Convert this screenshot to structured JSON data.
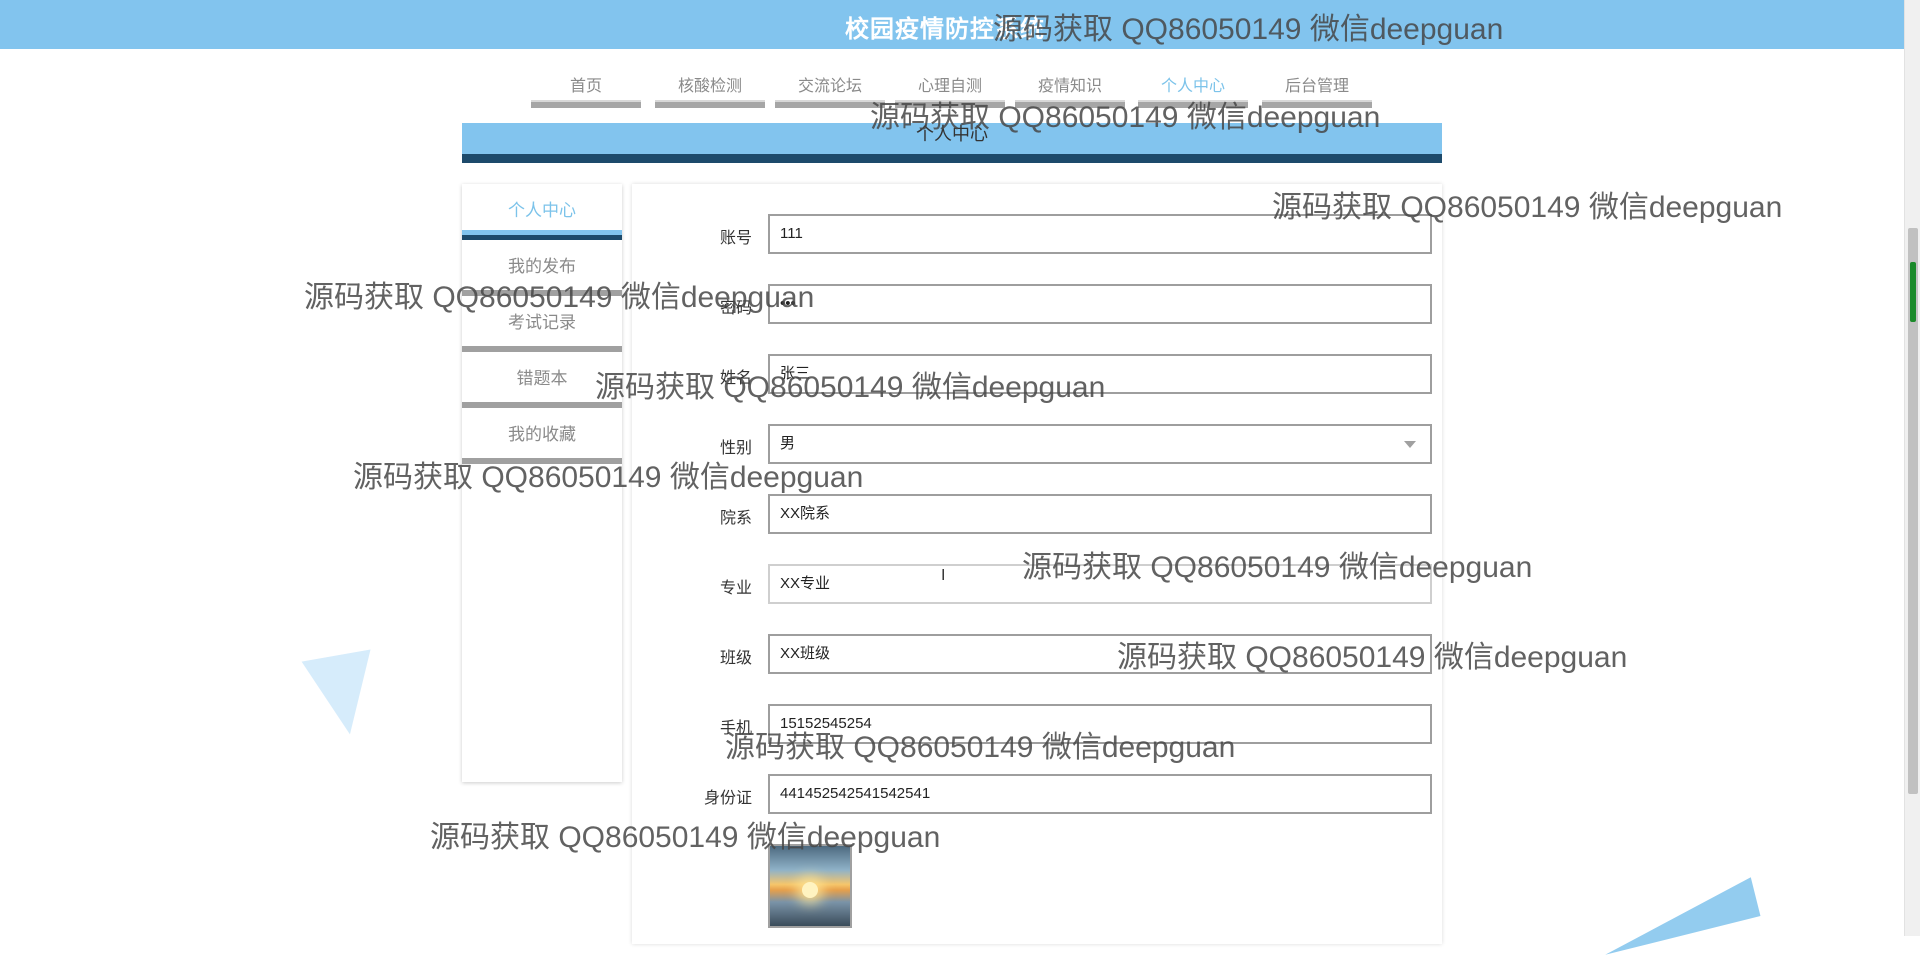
{
  "header": {
    "title": "校园疫情防控系统"
  },
  "nav": {
    "items": [
      {
        "label": "首页"
      },
      {
        "label": "核酸检测"
      },
      {
        "label": "交流论坛"
      },
      {
        "label": "心理自测"
      },
      {
        "label": "疫情知识"
      },
      {
        "label": "个人中心",
        "active": true
      },
      {
        "label": "后台管理"
      }
    ]
  },
  "section": {
    "title": "个人中心"
  },
  "sidebar": {
    "items": [
      {
        "label": "个人中心",
        "active": true
      },
      {
        "label": "我的发布"
      },
      {
        "label": "考试记录"
      },
      {
        "label": "错题本"
      },
      {
        "label": "我的收藏"
      }
    ]
  },
  "form": {
    "account": {
      "label": "账号",
      "value": "111"
    },
    "password": {
      "label": "密码",
      "value": "•••"
    },
    "name": {
      "label": "姓名",
      "value": "张三"
    },
    "gender": {
      "label": "性别",
      "value": "男"
    },
    "department": {
      "label": "院系",
      "value": "XX院系"
    },
    "major": {
      "label": "专业",
      "value": "XX专业"
    },
    "class": {
      "label": "班级",
      "value": "XX班级"
    },
    "phone": {
      "label": "手机",
      "value": "15152545254"
    },
    "id_card": {
      "label": "身份证",
      "value": "441452542541542541"
    }
  },
  "watermark": {
    "text": "源码获取 QQ86050149 微信deepguan"
  },
  "colors": {
    "accent": "#82c4ee",
    "dark": "#1d4a6b",
    "muted": "#8a8a8a"
  }
}
